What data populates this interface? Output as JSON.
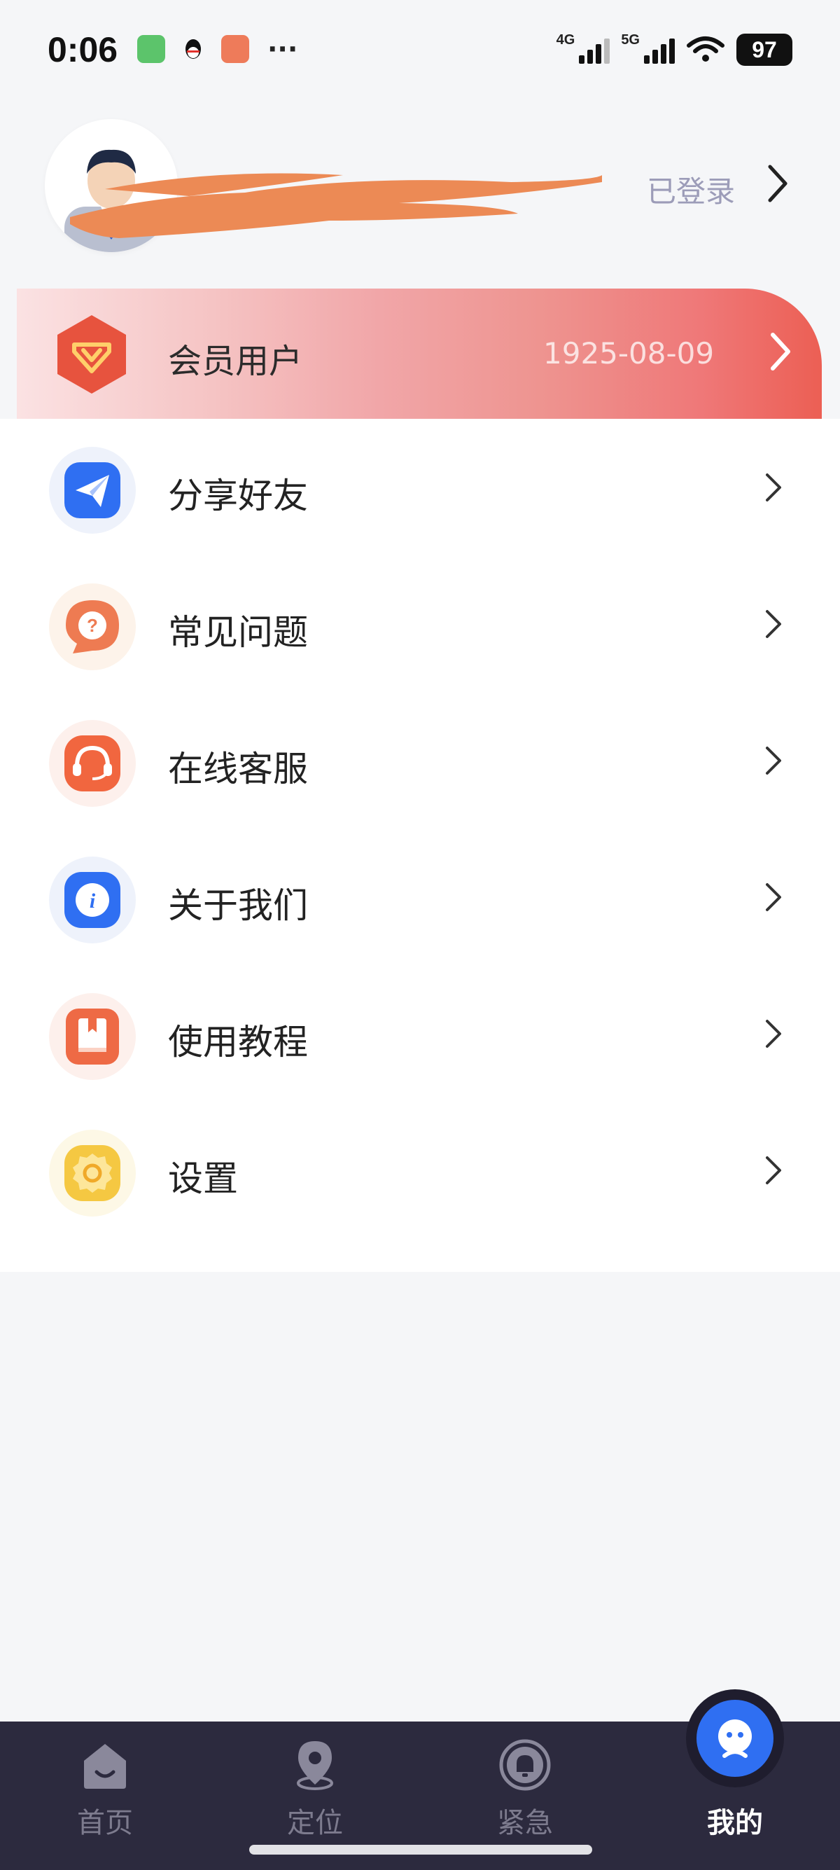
{
  "status_bar": {
    "time": "0:06",
    "more": "···",
    "net1": "4G",
    "net2": "5G",
    "battery": "97"
  },
  "profile": {
    "login_status": "已登录"
  },
  "vip": {
    "label": "会员用户",
    "expiry": "1925-08-09"
  },
  "menu": {
    "items": [
      {
        "label": "分享好友",
        "icon": "paper-plane-icon"
      },
      {
        "label": "常见问题",
        "icon": "question-bubble-icon"
      },
      {
        "label": "在线客服",
        "icon": "headset-icon"
      },
      {
        "label": "关于我们",
        "icon": "info-icon"
      },
      {
        "label": "使用教程",
        "icon": "book-icon"
      },
      {
        "label": "设置",
        "icon": "gear-icon"
      }
    ]
  },
  "tabbar": {
    "tabs": [
      {
        "label": "首页",
        "icon": "home-icon"
      },
      {
        "label": "定位",
        "icon": "location-pin-icon"
      },
      {
        "label": "紧急",
        "icon": "bell-icon"
      },
      {
        "label": "我的",
        "icon": "profile-face-icon"
      }
    ],
    "active": "我的"
  },
  "colors": {
    "vip_gradient_end": "#ec5f54",
    "tabbar_bg": "#2c2a3e",
    "active_tab_blue": "#2f6ff2",
    "login_text": "#9c9cb8"
  }
}
